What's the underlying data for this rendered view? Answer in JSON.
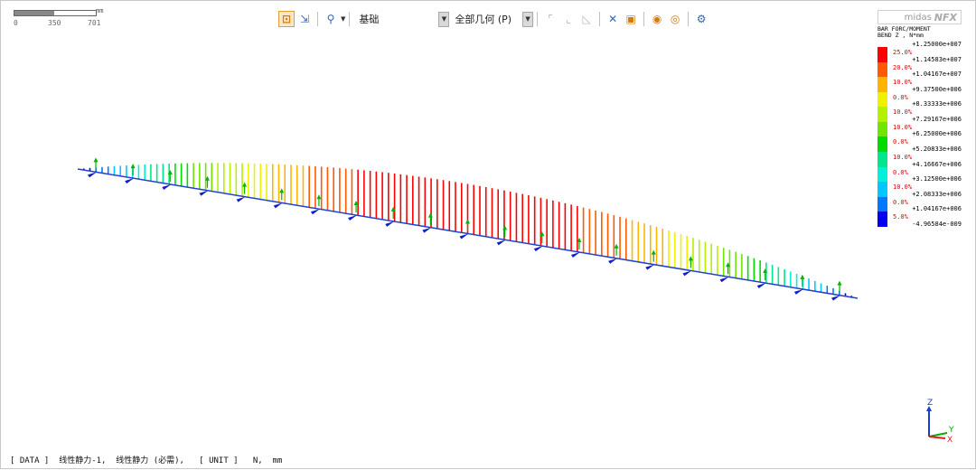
{
  "scale_bar": {
    "unit": "mm",
    "ticks": [
      "0",
      "350",
      "701"
    ]
  },
  "toolbar": {
    "view_label": "基础",
    "geometry_label": "全部几何 (P)"
  },
  "logo": {
    "brand": "midas",
    "product": "NFX"
  },
  "legend": {
    "title_line1": "BAR FORC/MOMENT",
    "title_line2": "BEND Z , N*mm",
    "values": [
      "+1.25000e+007",
      "+1.14583e+007",
      "+1.04167e+007",
      "+9.37500e+006",
      "+8.33333e+006",
      "+7.29167e+006",
      "+6.25000e+006",
      "+5.20833e+006",
      "+4.16667e+006",
      "+3.12500e+006",
      "+2.08333e+006",
      "+1.04167e+006",
      "-4.96584e-009"
    ],
    "percentages": [
      "25.0%",
      "20.0%",
      "10.0%",
      "0.0%",
      "10.0%",
      "10.0%",
      "0.0%",
      "10.0%",
      "0.0%",
      "10.0%",
      "0.0%",
      "5.0%"
    ],
    "colors": [
      "#ff0000",
      "#ff5a00",
      "#ffb400",
      "#f0f000",
      "#b4f000",
      "#6ee600",
      "#00dc00",
      "#00e68c",
      "#00f0dc",
      "#00c8ff",
      "#0078ff",
      "#0000f0"
    ]
  },
  "status": {
    "data_tag": "[ DATA ]",
    "data_text": "线性静力-1,  线性静力 (必需),",
    "unit_tag": "[ UNIT ]",
    "unit_text": "N,  mm"
  },
  "axes": {
    "z": "Z",
    "y": "Y",
    "x": "X"
  },
  "diagram": {
    "moment_max": 12500000,
    "moment_min": 0,
    "node_count": 129,
    "load_arrow_count": 21,
    "colors": {
      "load_arrow": "#00b400",
      "support": "#1020c8",
      "beam": "#2040d0"
    }
  }
}
